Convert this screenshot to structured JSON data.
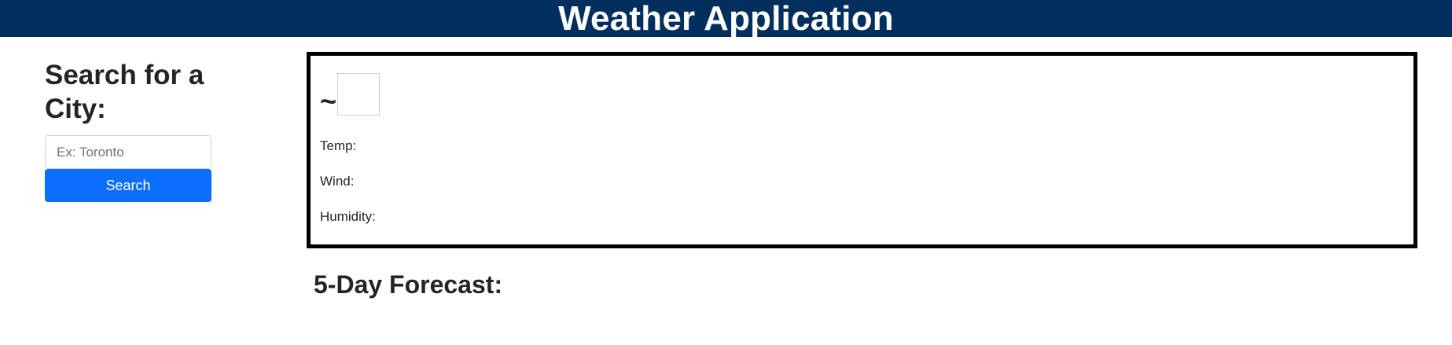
{
  "header": {
    "title": "Weather Application"
  },
  "sidebar": {
    "heading": "Search for a City:",
    "search_placeholder": "Ex: Toronto",
    "search_value": "",
    "search_button_label": "Search"
  },
  "current": {
    "city_label": "~",
    "temp_label": "Temp:",
    "wind_label": "Wind:",
    "humidity_label": "Humidity:"
  },
  "forecast": {
    "title": "5-Day Forecast:"
  },
  "colors": {
    "header_bg": "#022f5e",
    "button_bg": "#0d6efd",
    "card_border": "#000000"
  }
}
